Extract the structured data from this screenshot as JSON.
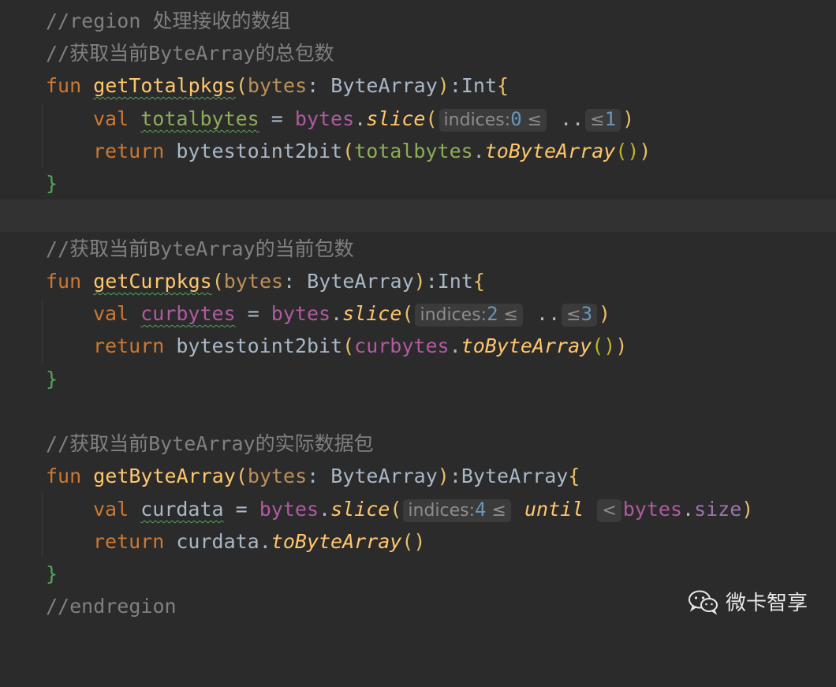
{
  "lines": [
    {
      "text": "//region 处理接收的数组"
    },
    {
      "text": "//获取当前ByteArray的总包数"
    },
    {
      "fun1": {
        "kw": "fun",
        "name": "getTotalpkgs",
        "open": "(",
        "param": "bytes",
        "colon": ": ",
        "type": "ByteArray",
        "close": ")",
        "ret": ":Int",
        "brace": "{"
      }
    },
    {
      "val1": {
        "kw": "val",
        "name": "totalbytes",
        "eq": " = ",
        "recv": "bytes",
        "dot": ".",
        "call": "slice",
        "open": "(",
        "hint_label": "indices:",
        "start": "0",
        "le1": "≤",
        "range": " ..",
        "le2": "≤",
        "end": "1",
        "close": ")"
      }
    },
    {
      "ret1": {
        "kw": "return",
        "fn": "bytestoint2bit",
        "open": "(",
        "arg": "totalbytes",
        "dot": ".",
        "call": "toByteArray",
        "parens": "()",
        "close": ")"
      }
    },
    {
      "close1": "}"
    },
    {
      "blank": ""
    },
    {
      "text": "//获取当前ByteArray的当前包数"
    },
    {
      "fun2": {
        "kw": "fun",
        "name": "getCurpkgs",
        "open": "(",
        "param": "bytes",
        "colon": ": ",
        "type": "ByteArray",
        "close": ")",
        "ret": ":Int",
        "brace": "{"
      }
    },
    {
      "val2": {
        "kw": "val",
        "name": "curbytes",
        "eq": " = ",
        "recv": "bytes",
        "dot": ".",
        "call": "slice",
        "open": "(",
        "hint_label": "indices:",
        "start": "2",
        "le1": "≤",
        "range": " ..",
        "le2": "≤",
        "end": "3",
        "close": ")"
      }
    },
    {
      "ret2": {
        "kw": "return",
        "fn": "bytestoint2bit",
        "open": "(",
        "arg": "curbytes",
        "dot": ".",
        "call": "toByteArray",
        "parens": "()",
        "close": ")"
      }
    },
    {
      "close2": "}"
    },
    {
      "blank": ""
    },
    {
      "text": "//获取当前ByteArray的实际数据包"
    },
    {
      "fun3": {
        "kw": "fun",
        "name": "getByteArray",
        "open": "(",
        "param": "bytes",
        "colon": ": ",
        "type": "ByteArray",
        "close": ")",
        "ret": ":ByteArray",
        "brace": "{"
      }
    },
    {
      "val3": {
        "kw": "val",
        "name": "curdata",
        "eq": " = ",
        "recv": "bytes",
        "dot": ".",
        "call": "slice",
        "open": "(",
        "hint_label": "indices:",
        "start": "4",
        "le1": "≤",
        "until": "until",
        "lt": "<",
        "recv2": "bytes",
        "dot2": ".",
        "prop": "size",
        "close": ")"
      }
    },
    {
      "ret3": {
        "kw": "return",
        "arg": "curdata",
        "dot": ".",
        "call": "toByteArray",
        "parens": "()"
      }
    },
    {
      "close3": "}"
    },
    {
      "text": "//endregion"
    }
  ],
  "watermark": {
    "text": "微卡智享",
    "icon": "wechat-icon"
  },
  "colors": {
    "background": "#2b2b2b",
    "current_line": "#323232",
    "comment": "#808080",
    "keyword": "#cc7832",
    "function": "#ffc66d",
    "number": "#6897bb",
    "property": "#9876aa"
  }
}
